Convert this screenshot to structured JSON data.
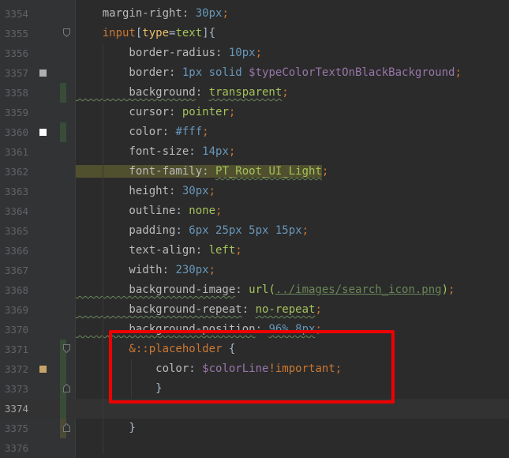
{
  "editor": {
    "lines": [
      {
        "n": "3354",
        "marker": "",
        "vcs": "",
        "fold": "",
        "code": [
          {
            "t": "    margin-right",
            "c": "prop",
            "i": 1
          },
          {
            "t": ": ",
            "c": ""
          },
          {
            "t": "30px",
            "c": "num"
          },
          {
            "t": ";",
            "c": "punc"
          }
        ]
      },
      {
        "n": "3355",
        "marker": "",
        "vcs": "",
        "fold": "open",
        "code": [
          {
            "t": "    input",
            "c": "sel",
            "i": 1
          },
          {
            "t": "[",
            "c": ""
          },
          {
            "t": "type",
            "c": "tag"
          },
          {
            "t": "=",
            "c": ""
          },
          {
            "t": "text",
            "c": "str"
          },
          {
            "t": "]{",
            "c": ""
          }
        ]
      },
      {
        "n": "3356",
        "marker": "",
        "vcs": "",
        "fold": "",
        "code": [
          {
            "t": "        border-radius",
            "c": "prop",
            "i": 2
          },
          {
            "t": ": ",
            "c": ""
          },
          {
            "t": "10px",
            "c": "num"
          },
          {
            "t": ";",
            "c": "punc"
          }
        ]
      },
      {
        "n": "3357",
        "marker": "#afafaf",
        "vcs": "",
        "fold": "",
        "code": [
          {
            "t": "        border",
            "c": "prop",
            "i": 2
          },
          {
            "t": ": ",
            "c": ""
          },
          {
            "t": "1px solid ",
            "c": "num"
          },
          {
            "t": "$typeColorTextOnBlackBackground",
            "c": "var"
          },
          {
            "t": ";",
            "c": "punc"
          }
        ]
      },
      {
        "n": "3358",
        "marker": "",
        "vcs": "green",
        "fold": "",
        "code": [
          {
            "t": "        background",
            "c": "prop typo",
            "i": 2
          },
          {
            "t": ": ",
            "c": ""
          },
          {
            "t": "transparent",
            "c": "str typo"
          },
          {
            "t": ";",
            "c": "punc"
          }
        ]
      },
      {
        "n": "3359",
        "marker": "",
        "vcs": "",
        "fold": "",
        "code": [
          {
            "t": "        cursor",
            "c": "prop",
            "i": 2
          },
          {
            "t": ": ",
            "c": ""
          },
          {
            "t": "pointer",
            "c": "str"
          },
          {
            "t": ";",
            "c": "punc"
          }
        ]
      },
      {
        "n": "3360",
        "marker": "#ffffff",
        "vcs": "green",
        "fold": "",
        "code": [
          {
            "t": "        color",
            "c": "prop",
            "i": 2
          },
          {
            "t": ": ",
            "c": ""
          },
          {
            "t": "#fff",
            "c": "num"
          },
          {
            "t": ";",
            "c": "punc"
          }
        ]
      },
      {
        "n": "3361",
        "marker": "",
        "vcs": "",
        "fold": "",
        "code": [
          {
            "t": "        font-size",
            "c": "prop",
            "i": 2
          },
          {
            "t": ": ",
            "c": ""
          },
          {
            "t": "14px",
            "c": "num"
          },
          {
            "t": ";",
            "c": "punc"
          }
        ]
      },
      {
        "n": "3362",
        "marker": "",
        "vcs": "",
        "fold": "",
        "code": [
          {
            "t": "        font-family",
            "c": "prop hl-warn",
            "i": 2
          },
          {
            "t": ": ",
            "c": "hl-warn"
          },
          {
            "t": "PT_Root_UI_Light",
            "c": "str hl-warn typo"
          },
          {
            "t": ";",
            "c": "punc"
          }
        ]
      },
      {
        "n": "3363",
        "marker": "",
        "vcs": "",
        "fold": "",
        "code": [
          {
            "t": "        height",
            "c": "prop",
            "i": 2
          },
          {
            "t": ": ",
            "c": ""
          },
          {
            "t": "30px",
            "c": "num"
          },
          {
            "t": ";",
            "c": "punc"
          }
        ]
      },
      {
        "n": "3364",
        "marker": "",
        "vcs": "",
        "fold": "",
        "code": [
          {
            "t": "        outline",
            "c": "prop",
            "i": 2
          },
          {
            "t": ": ",
            "c": ""
          },
          {
            "t": "none",
            "c": "str"
          },
          {
            "t": ";",
            "c": "punc"
          }
        ]
      },
      {
        "n": "3365",
        "marker": "",
        "vcs": "",
        "fold": "",
        "code": [
          {
            "t": "        padding",
            "c": "prop",
            "i": 2
          },
          {
            "t": ": ",
            "c": ""
          },
          {
            "t": "6px 25px 5px 15px",
            "c": "num"
          },
          {
            "t": ";",
            "c": "punc"
          }
        ]
      },
      {
        "n": "3366",
        "marker": "",
        "vcs": "",
        "fold": "",
        "code": [
          {
            "t": "        text-align",
            "c": "prop",
            "i": 2
          },
          {
            "t": ": ",
            "c": ""
          },
          {
            "t": "left",
            "c": "str"
          },
          {
            "t": ";",
            "c": "punc"
          }
        ]
      },
      {
        "n": "3367",
        "marker": "",
        "vcs": "",
        "fold": "",
        "code": [
          {
            "t": "        width",
            "c": "prop",
            "i": 2
          },
          {
            "t": ": ",
            "c": ""
          },
          {
            "t": "230px",
            "c": "num"
          },
          {
            "t": ";",
            "c": "punc"
          }
        ]
      },
      {
        "n": "3368",
        "marker": "",
        "vcs": "",
        "fold": "",
        "code": [
          {
            "t": "        background-image",
            "c": "prop typo",
            "i": 2
          },
          {
            "t": ": ",
            "c": ""
          },
          {
            "t": "url(",
            "c": "str"
          },
          {
            "t": "../images/search_icon.png",
            "c": "url"
          },
          {
            "t": ")",
            "c": "str"
          },
          {
            "t": ";",
            "c": "punc"
          }
        ]
      },
      {
        "n": "3369",
        "marker": "",
        "vcs": "",
        "fold": "",
        "code": [
          {
            "t": "        background-repeat",
            "c": "prop typo",
            "i": 2
          },
          {
            "t": ": ",
            "c": ""
          },
          {
            "t": "no-repeat",
            "c": "str typo"
          },
          {
            "t": ";",
            "c": "punc"
          }
        ]
      },
      {
        "n": "3370",
        "marker": "",
        "vcs": "",
        "fold": "",
        "code": [
          {
            "t": "        background-position",
            "c": "prop typo",
            "i": 2
          },
          {
            "t": ": ",
            "c": ""
          },
          {
            "t": "96% 8px",
            "c": "num typo"
          },
          {
            "t": ";",
            "c": "punc"
          }
        ]
      },
      {
        "n": "3371",
        "marker": "",
        "vcs": "green",
        "fold": "open",
        "code": [
          {
            "t": "        &::placeholder",
            "c": "sel",
            "i": 2
          },
          {
            "t": " {",
            "c": ""
          }
        ]
      },
      {
        "n": "3372",
        "marker": "#c8a36a",
        "vcs": "green",
        "fold": "",
        "code": [
          {
            "t": "            color",
            "c": "prop",
            "i": 3
          },
          {
            "t": ": ",
            "c": ""
          },
          {
            "t": "$colorLine",
            "c": "var"
          },
          {
            "t": "!important",
            "c": "sel"
          },
          {
            "t": ";",
            "c": "punc"
          }
        ]
      },
      {
        "n": "3373",
        "marker": "",
        "vcs": "green",
        "fold": "close",
        "code": [
          {
            "t": "            }",
            "c": "",
            "i": 3
          }
        ]
      },
      {
        "n": "3374",
        "marker": "",
        "vcs": "green",
        "fold": "",
        "current": true,
        "code": []
      },
      {
        "n": "3375",
        "marker": "",
        "vcs": "olive",
        "fold": "close",
        "code": [
          {
            "t": "        }",
            "c": "",
            "i": 2
          }
        ]
      },
      {
        "n": "3376",
        "marker": "",
        "vcs": "",
        "fold": "",
        "code": []
      }
    ]
  }
}
